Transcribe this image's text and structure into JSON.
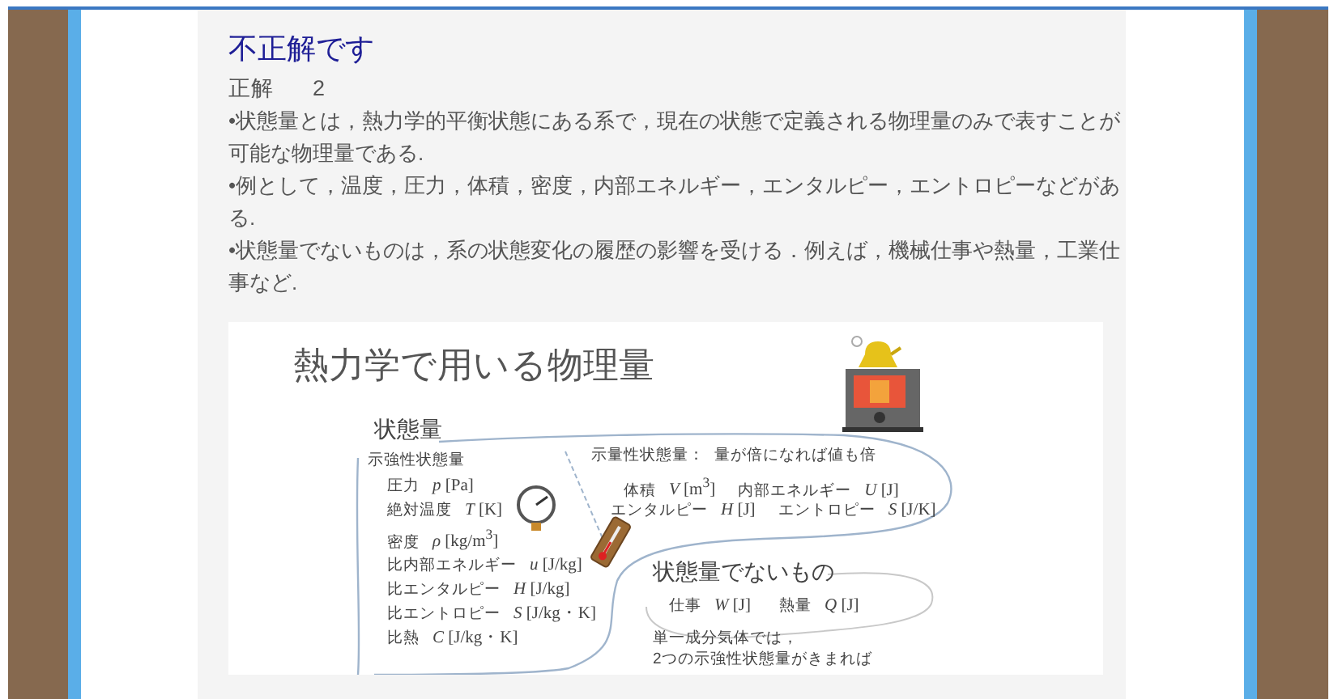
{
  "result": {
    "title": "不正解です",
    "answer_label": "正解",
    "answer": "2"
  },
  "explanation": [
    "•状態量とは，熱力学的平衡状態にある系で，現在の状態で定義される物理量のみで表すことが可能な物理量である.",
    "•例として，温度，圧力，体積，密度，内部エネルギー，エンタルピー，エントロピーなどがある.",
    "•状態量でないものは，系の状態変化の履歴の影響を受ける．例えば，機械仕事や熱量，工業仕事など."
  ],
  "figure": {
    "title": "熱力学で用いる物理量",
    "state_quantity": {
      "heading": "状態量",
      "intensive": {
        "heading": "示強性状態量",
        "rows": [
          {
            "name": "圧力",
            "symbol": "*p* [Pa]"
          },
          {
            "name": "絶対温度",
            "symbol": "*T* [K]"
          },
          {
            "name": "密度",
            "symbol": "*ρ* [kg/m$^{3}$]"
          },
          {
            "name": "比内部エネルギー",
            "symbol": "*u* [J/kg]"
          },
          {
            "name": "比エンタルピー",
            "symbol": "*H* [J/kg]"
          },
          {
            "name": "比エントロピー",
            "symbol": "*S* [J/kg・K]"
          },
          {
            "name": "比熱",
            "symbol": "*C* [J/kg・K]"
          }
        ]
      },
      "extensive": {
        "heading": "示量性状態量：",
        "note": "量が倍になれば値も倍",
        "rows": [
          [
            {
              "name": "体積",
              "symbol": "*V* [m$^{3}$]"
            },
            {
              "name": "内部エネルギー",
              "symbol": "*U* [J]"
            }
          ],
          [
            {
              "name": "エンタルピー",
              "symbol": "*H* [J]"
            },
            {
              "name": "エントロピー",
              "symbol": "*S* [J/K]"
            }
          ]
        ]
      }
    },
    "non_state": {
      "heading": "状態量でないもの",
      "items": [
        {
          "name": "仕事",
          "symbol": "*W* [J]"
        },
        {
          "name": "熱量",
          "symbol": "*Q* [J]"
        }
      ]
    },
    "note": [
      "単一成分気体では，",
      "2つの示強性状態量がきまれば"
    ]
  }
}
